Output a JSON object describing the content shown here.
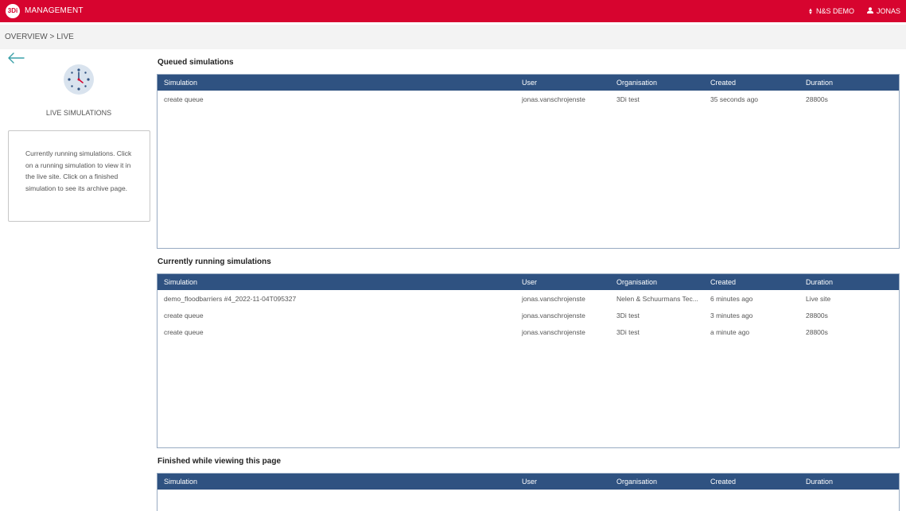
{
  "topbar": {
    "logo_text": "3Di",
    "title": "MANAGEMENT",
    "org": "N&S DEMO",
    "user": "JONAS"
  },
  "breadcrumb": "OVERVIEW > LIVE",
  "sidebar": {
    "title": "LIVE SIMULATIONS",
    "info": "Currently running simulations. Click on a running simulation to view it in the live site. Click on a finished simulation to see its archive page."
  },
  "columns": [
    "Simulation",
    "User",
    "Organisation",
    "Created",
    "Duration"
  ],
  "queued": {
    "title": "Queued simulations",
    "rows": [
      [
        "create queue",
        "jonas.vanschrojenste",
        "3Di test",
        "35 seconds ago",
        "28800s"
      ]
    ]
  },
  "running": {
    "title": "Currently running simulations",
    "rows": [
      [
        "demo_floodbarriers #4_2022-11-04T095327",
        "jonas.vanschrojenste",
        "Nelen & Schuurmans Tec...",
        "6 minutes ago",
        "Live site"
      ],
      [
        "create queue",
        "jonas.vanschrojenste",
        "3Di test",
        "3 minutes ago",
        "28800s"
      ],
      [
        "create queue",
        "jonas.vanschrojenste",
        "3Di test",
        "a minute ago",
        "28800s"
      ]
    ]
  },
  "finished": {
    "title": "Finished while viewing this page",
    "rows": []
  },
  "colors": {
    "brand_red": "#d7042f",
    "table_header": "#2f5281",
    "accent_teal": "#3aa0a8"
  },
  "icons": {
    "logo": "3di-logo-icon",
    "org_switch": "updown-icon",
    "user": "person-icon",
    "back": "arrow-left-icon",
    "live": "clock-icon"
  }
}
